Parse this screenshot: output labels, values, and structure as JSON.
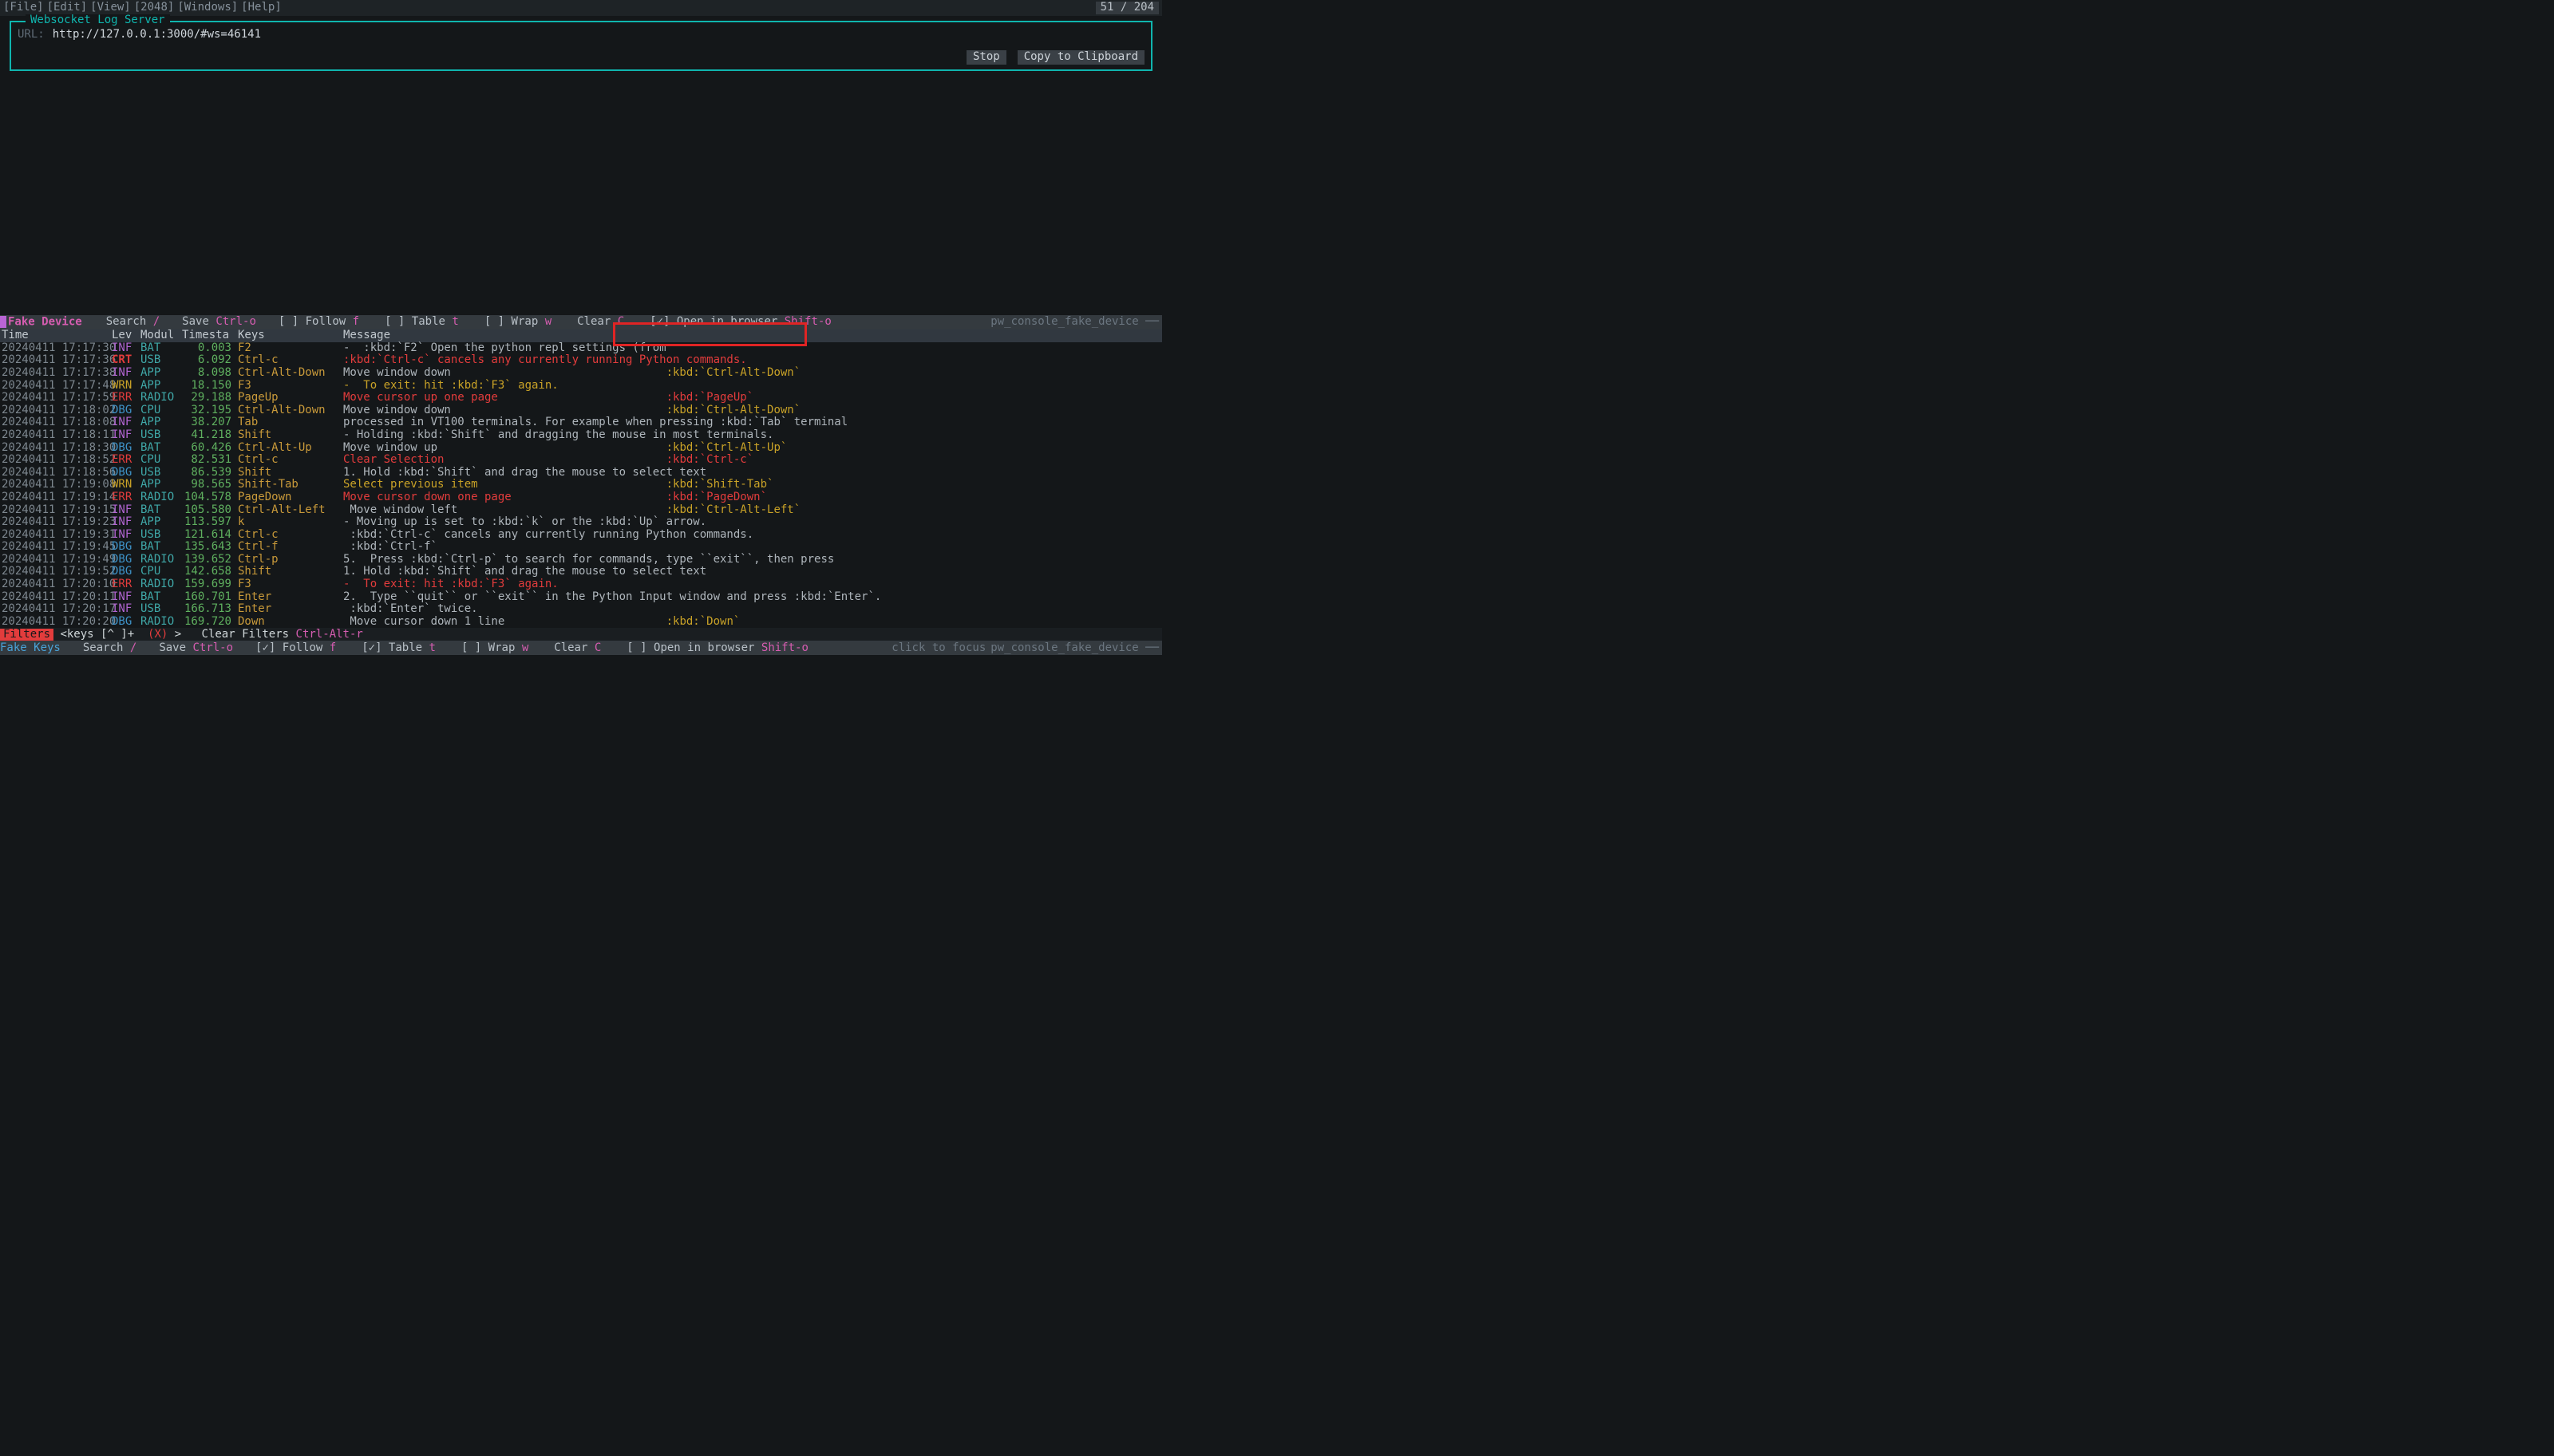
{
  "menu": {
    "items": [
      "[File]",
      "[Edit]",
      "[View]",
      "[2048]",
      "[Windows]",
      "[Help]"
    ],
    "counter": "51 / 204"
  },
  "panel": {
    "title": "Websocket Log Server",
    "url_label": "URL:",
    "url": "http://127.0.0.1:3000/#ws=46141",
    "stop": "Stop",
    "copy": "Copy to Clipboard"
  },
  "toolbar1": {
    "fake": "Fake Device",
    "search": "Search",
    "search_k": "/",
    "save": "Save",
    "save_k": "Ctrl-o",
    "follow": "[ ] Follow",
    "follow_k": "f",
    "table": "[ ] Table",
    "table_k": "t",
    "wrap": "[ ] Wrap",
    "wrap_k": "w",
    "clear": "Clear",
    "clear_k": "C",
    "open": "[✓] Open in browser",
    "open_k": "Shift-o",
    "device_name": "pw_console_fake_device ──"
  },
  "cols": {
    "time": "Time",
    "lev": "Lev",
    "mod": "Modul",
    "ts": "Timesta",
    "keys": "Keys",
    "msg": "Message"
  },
  "rows": [
    {
      "time": "20240411 17:17:30",
      "lev": "INF",
      "lc": "c-inf",
      "mod": "BAT",
      "ts": "0.003",
      "key": "F2",
      "msg": "-  :kbd:`F2` Open the python repl settings (from",
      "kbd": ""
    },
    {
      "time": "20240411 17:17:36",
      "lev": "CRT",
      "lc": "c-crt",
      "mod": "USB",
      "ts": "6.092",
      "key": "Ctrl-c",
      "msg": ":kbd:`Ctrl-c` cancels any currently running Python commands.",
      "cls": "msg-r",
      "kbd": ""
    },
    {
      "time": "20240411 17:17:38",
      "lev": "INF",
      "lc": "c-inf",
      "mod": "APP",
      "ts": "8.098",
      "key": "Ctrl-Alt-Down",
      "msg": "Move window down",
      "kbd": ":kbd:`Ctrl-Alt-Down`"
    },
    {
      "time": "20240411 17:17:48",
      "lev": "WRN",
      "lc": "c-wrn",
      "mod": "APP",
      "ts": "18.150",
      "key": "F3",
      "msg": "-  To exit: hit :kbd:`F3` again.",
      "cls": "msg-y",
      "kbd": ""
    },
    {
      "time": "20240411 17:17:59",
      "lev": "ERR",
      "lc": "c-err",
      "mod": "RADIO",
      "ts": "29.188",
      "key": "PageUp",
      "msg": "Move cursor up one page",
      "cls": "msg-r",
      "kbd": ":kbd:`PageUp`",
      "kbdcls": "msg-r"
    },
    {
      "time": "20240411 17:18:02",
      "lev": "DBG",
      "lc": "c-dbg",
      "mod": "CPU",
      "ts": "32.195",
      "key": "Ctrl-Alt-Down",
      "msg": "Move window down",
      "kbd": ":kbd:`Ctrl-Alt-Down`"
    },
    {
      "time": "20240411 17:18:08",
      "lev": "INF",
      "lc": "c-inf",
      "mod": "APP",
      "ts": "38.207",
      "key": "Tab",
      "msg": "processed in VT100 terminals. For example when pressing :kbd:`Tab` terminal",
      "kbd": ""
    },
    {
      "time": "20240411 17:18:11",
      "lev": "INF",
      "lc": "c-inf",
      "mod": "USB",
      "ts": "41.218",
      "key": "Shift",
      "msg": "- Holding :kbd:`Shift` and dragging the mouse in most terminals.",
      "kbd": ""
    },
    {
      "time": "20240411 17:18:30",
      "lev": "DBG",
      "lc": "c-dbg",
      "mod": "BAT",
      "ts": "60.426",
      "key": "Ctrl-Alt-Up",
      "msg": "Move window up",
      "kbd": ":kbd:`Ctrl-Alt-Up`"
    },
    {
      "time": "20240411 17:18:52",
      "lev": "ERR",
      "lc": "c-err",
      "mod": "CPU",
      "ts": "82.531",
      "key": "Ctrl-c",
      "msg": "Clear Selection",
      "cls": "msg-r",
      "kbd": ":kbd:`Ctrl-c`",
      "kbdcls": "msg-r"
    },
    {
      "time": "20240411 17:18:56",
      "lev": "DBG",
      "lc": "c-dbg",
      "mod": "USB",
      "ts": "86.539",
      "key": "Shift",
      "msg": "1. Hold :kbd:`Shift` and drag the mouse to select text",
      "kbd": ""
    },
    {
      "time": "20240411 17:19:08",
      "lev": "WRN",
      "lc": "c-wrn",
      "mod": "APP",
      "ts": "98.565",
      "key": "Shift-Tab",
      "msg": "Select previous item",
      "cls": "msg-y",
      "kbd": ":kbd:`Shift-Tab`",
      "kbdcls": "msg-y"
    },
    {
      "time": "20240411 17:19:14",
      "lev": "ERR",
      "lc": "c-err",
      "mod": "RADIO",
      "ts": "104.578",
      "key": "PageDown",
      "msg": "Move cursor down one page",
      "cls": "msg-r",
      "kbd": ":kbd:`PageDown`",
      "kbdcls": "msg-r"
    },
    {
      "time": "20240411 17:19:15",
      "lev": "INF",
      "lc": "c-inf",
      "mod": "BAT",
      "ts": "105.580",
      "key": "Ctrl-Alt-Left",
      "msg": " Move window left",
      "kbd": ":kbd:`Ctrl-Alt-Left`"
    },
    {
      "time": "20240411 17:19:23",
      "lev": "INF",
      "lc": "c-inf",
      "mod": "APP",
      "ts": "113.597",
      "key": "k",
      "msg": "- Moving up is set to :kbd:`k` or the :kbd:`Up` arrow.",
      "kbd": ""
    },
    {
      "time": "20240411 17:19:31",
      "lev": "INF",
      "lc": "c-inf",
      "mod": "USB",
      "ts": "121.614",
      "key": "Ctrl-c",
      "msg": " :kbd:`Ctrl-c` cancels any currently running Python commands.",
      "kbd": ""
    },
    {
      "time": "20240411 17:19:45",
      "lev": "DBG",
      "lc": "c-dbg",
      "mod": "BAT",
      "ts": "135.643",
      "key": "Ctrl-f",
      "msg": " :kbd:`Ctrl-f`",
      "kbd": ""
    },
    {
      "time": "20240411 17:19:49",
      "lev": "DBG",
      "lc": "c-dbg",
      "mod": "RADIO",
      "ts": "139.652",
      "key": "Ctrl-p",
      "msg": "5.  Press :kbd:`Ctrl-p` to search for commands, type ``exit``, then press",
      "kbd": ""
    },
    {
      "time": "20240411 17:19:52",
      "lev": "DBG",
      "lc": "c-dbg",
      "mod": "CPU",
      "ts": "142.658",
      "key": "Shift",
      "msg": "1. Hold :kbd:`Shift` and drag the mouse to select text",
      "kbd": ""
    },
    {
      "time": "20240411 17:20:10",
      "lev": "ERR",
      "lc": "c-err",
      "mod": "RADIO",
      "ts": "159.699",
      "key": "F3",
      "msg": "-  To exit: hit :kbd:`F3` again.",
      "cls": "msg-r",
      "kbd": ""
    },
    {
      "time": "20240411 17:20:11",
      "lev": "INF",
      "lc": "c-inf",
      "mod": "BAT",
      "ts": "160.701",
      "key": "Enter",
      "msg": "2.  Type ``quit`` or ``exit`` in the Python Input window and press :kbd:`Enter`.",
      "kbd": ""
    },
    {
      "time": "20240411 17:20:17",
      "lev": "INF",
      "lc": "c-inf",
      "mod": "USB",
      "ts": "166.713",
      "key": "Enter",
      "msg": " :kbd:`Enter` twice.",
      "kbd": ""
    },
    {
      "time": "20240411 17:20:20",
      "lev": "DBG",
      "lc": "c-dbg",
      "mod": "RADIO",
      "ts": "169.720",
      "key": "Down",
      "msg": " Move cursor down 1 line",
      "kbd": ":kbd:`Down`"
    }
  ],
  "filters": {
    "tag": "Filters",
    "keys": "<keys [^ ]+",
    "x": "(X)",
    "gt": ">",
    "clear": "Clear Filters",
    "clear_k": "Ctrl-Alt-r"
  },
  "toolbar2": {
    "fake": "Fake Keys",
    "search": "Search",
    "search_k": "/",
    "save": "Save",
    "save_k": "Ctrl-o",
    "follow": "[✓] Follow",
    "follow_k": "f",
    "table": "[✓] Table",
    "table_k": "t",
    "wrap": "[ ] Wrap",
    "wrap_k": "w",
    "clear": "Clear",
    "clear_k": "C",
    "open": "[ ] Open in browser",
    "open_k": "Shift-o",
    "click": "click to focus",
    "dev": "pw_console_fake_device ──"
  }
}
